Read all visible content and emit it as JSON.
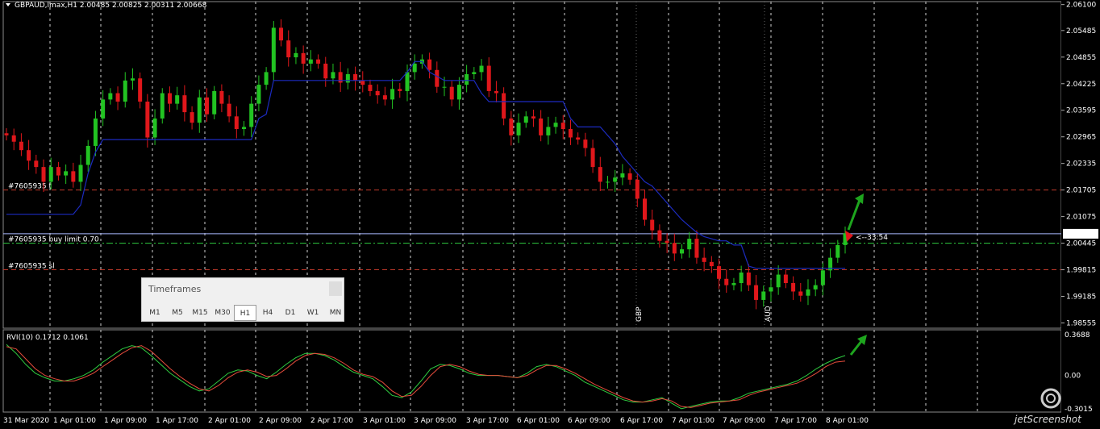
{
  "header": {
    "title": "GBPAUD,lmax,H1  2.00485 2.00825 2.00311 2.00668"
  },
  "chart_data": {
    "type": "candlestick",
    "symbol": "GBPAUD,lmax",
    "timeframe": "H1",
    "ohlc_header": [
      2.00485,
      2.00825,
      2.00311,
      2.00668
    ],
    "y_ticks": [
      "2.06100",
      "2.05485",
      "2.04855",
      "2.04225",
      "2.03595",
      "2.02965",
      "2.02335",
      "2.01705",
      "2.01075",
      "2.00445",
      "1.99815",
      "1.99185",
      "1.98555"
    ],
    "x_ticks": [
      "31 Mar 2020",
      "1 Apr 01:00",
      "1 Apr 09:00",
      "1 Apr 17:00",
      "2 Apr 01:00",
      "2 Apr 09:00",
      "2 Apr 17:00",
      "3 Apr 01:00",
      "3 Apr 09:00",
      "3 Apr 17:00",
      "6 Apr 01:00",
      "6 Apr 09:00",
      "6 Apr 17:00",
      "7 Apr 01:00",
      "7 Apr 09:00",
      "7 Apr 17:00",
      "8 Apr 01:00"
    ],
    "ylim": [
      1.9843,
      2.0617
    ],
    "current_price": "2.00668",
    "countdown": "<--33:54",
    "order_lines": [
      {
        "label": "#7605935 t",
        "price": 2.01705,
        "color": "#c0392b",
        "dash": "dashed"
      },
      {
        "label": "#7605935 buy limit 0.70",
        "price": 2.00445,
        "color": "#2ecc40",
        "dash": "dashdot"
      },
      {
        "label": "#7605935 sl",
        "price": 1.99815,
        "color": "#c0392b",
        "dash": "dashed"
      }
    ],
    "events": [
      "GBP",
      "AUD"
    ],
    "close_series": [
      2.03,
      2.0285,
      2.0265,
      2.024,
      2.0225,
      2.019,
      2.0225,
      2.0205,
      2.0215,
      2.019,
      2.023,
      2.0275,
      2.034,
      2.0385,
      2.04,
      2.038,
      2.043,
      2.0435,
      2.038,
      2.0295,
      2.034,
      2.04,
      2.0375,
      2.0395,
      2.0355,
      2.033,
      2.039,
      2.035,
      2.0405,
      2.0375,
      2.0345,
      2.0315,
      2.032,
      2.0375,
      2.042,
      2.045,
      2.0555,
      2.0525,
      2.0485,
      2.0495,
      2.047,
      2.048,
      2.047,
      2.0435,
      2.045,
      2.0425,
      2.0445,
      2.043,
      2.042,
      2.0405,
      2.0395,
      2.0385,
      2.041,
      2.0405,
      2.045,
      2.047,
      2.048,
      2.0455,
      2.0415,
      2.0415,
      2.0385,
      2.042,
      2.0445,
      2.045,
      2.0465,
      2.0405,
      2.04,
      2.034,
      2.03,
      2.033,
      2.0345,
      2.034,
      2.03,
      2.032,
      2.033,
      2.0315,
      2.0295,
      2.029,
      2.027,
      2.0225,
      2.019,
      2.019,
      2.02,
      2.021,
      2.0195,
      2.015,
      2.01,
      2.0075,
      2.005,
      2.0045,
      2.002,
      2.003,
      2.0055,
      2.001,
      2.0,
      1.999,
      1.996,
      1.9945,
      1.995,
      1.9975,
      1.9945,
      1.991,
      1.993,
      1.994,
      1.997,
      1.995,
      1.993,
      1.992,
      1.9935,
      1.9945,
      1.998,
      2.001,
      2.004,
      2.0068
    ],
    "line_series": [
      {
        "name": "",
        "color": "#1c2bbf",
        "values": [
          2.0113,
          2.0113,
          2.0113,
          2.0113,
          2.0113,
          2.0113,
          2.0113,
          2.0113,
          2.0113,
          2.0113,
          2.0135,
          2.021,
          2.026,
          2.029,
          2.029,
          2.029,
          2.029,
          2.029,
          2.029,
          2.029,
          2.029,
          2.029,
          2.029,
          2.029,
          2.029,
          2.029,
          2.029,
          2.029,
          2.029,
          2.029,
          2.029,
          2.029,
          2.029,
          2.029,
          2.034,
          2.035,
          2.043,
          2.043,
          2.043,
          2.043,
          2.043,
          2.043,
          2.043,
          2.043,
          2.043,
          2.043,
          2.043,
          2.043,
          2.043,
          2.043,
          2.043,
          2.043,
          2.043,
          2.043,
          2.045,
          2.0475,
          2.0475,
          2.045,
          2.044,
          2.043,
          2.043,
          2.043,
          2.043,
          2.043,
          2.04,
          2.038,
          2.038,
          2.038,
          2.038,
          2.038,
          2.038,
          2.038,
          2.038,
          2.038,
          2.038,
          2.038,
          2.034,
          2.032,
          2.032,
          2.032,
          2.032,
          2.03,
          2.028,
          2.025,
          2.023,
          2.021,
          2.019,
          2.018,
          2.016,
          2.014,
          2.012,
          2.01,
          2.0085,
          2.007,
          2.006,
          2.0055,
          2.005,
          2.005,
          2.004,
          2.004,
          1.999,
          1.9985,
          1.9985,
          1.9985,
          1.9985,
          1.9985,
          1.9985,
          1.9985,
          1.9985,
          1.9985,
          1.9985,
          1.9985,
          1.9985,
          1.9985
        ]
      }
    ],
    "sub_window": {
      "title": "RVI(10) 0.1712 0.1061",
      "ylim": [
        -0.3015,
        0.3688
      ],
      "y_ticks": [
        "0.3688",
        "0.00",
        "-0.3015"
      ],
      "series": [
        {
          "name": "",
          "color": "#2ecc40",
          "values": [
            0.28,
            0.2,
            0.1,
            0.02,
            -0.02,
            -0.05,
            -0.05,
            -0.03,
            0.0,
            0.05,
            0.12,
            0.18,
            0.24,
            0.27,
            0.25,
            0.18,
            0.1,
            0.02,
            -0.04,
            -0.1,
            -0.14,
            -0.12,
            -0.05,
            0.02,
            0.05,
            0.04,
            0.0,
            -0.03,
            0.03,
            0.1,
            0.16,
            0.2,
            0.2,
            0.18,
            0.14,
            0.08,
            0.03,
            0.0,
            -0.03,
            -0.1,
            -0.18,
            -0.2,
            -0.15,
            -0.05,
            0.06,
            0.1,
            0.09,
            0.06,
            0.02,
            0.0,
            0.0,
            0.0,
            -0.01,
            -0.02,
            0.02,
            0.08,
            0.1,
            0.08,
            0.04,
            0.0,
            -0.06,
            -0.1,
            -0.14,
            -0.18,
            -0.22,
            -0.24,
            -0.24,
            -0.22,
            -0.2,
            -0.25,
            -0.3,
            -0.28,
            -0.26,
            -0.24,
            -0.23,
            -0.23,
            -0.2,
            -0.16,
            -0.14,
            -0.12,
            -0.1,
            -0.08,
            -0.05,
            0.0,
            0.06,
            0.11,
            0.15,
            0.18
          ]
        },
        {
          "name": "",
          "color": "#e74c3c",
          "values": [
            0.26,
            0.24,
            0.15,
            0.06,
            0.0,
            -0.03,
            -0.05,
            -0.05,
            -0.02,
            0.02,
            0.08,
            0.14,
            0.2,
            0.25,
            0.27,
            0.22,
            0.14,
            0.06,
            -0.01,
            -0.07,
            -0.12,
            -0.14,
            -0.09,
            -0.02,
            0.03,
            0.05,
            0.03,
            -0.01,
            0.0,
            0.06,
            0.13,
            0.18,
            0.2,
            0.19,
            0.16,
            0.11,
            0.05,
            0.01,
            -0.01,
            -0.06,
            -0.14,
            -0.19,
            -0.18,
            -0.1,
            0.0,
            0.08,
            0.1,
            0.08,
            0.04,
            0.01,
            0.0,
            0.0,
            -0.01,
            -0.02,
            0.0,
            0.05,
            0.09,
            0.09,
            0.06,
            0.02,
            -0.03,
            -0.08,
            -0.12,
            -0.16,
            -0.2,
            -0.23,
            -0.24,
            -0.23,
            -0.21,
            -0.23,
            -0.28,
            -0.29,
            -0.27,
            -0.25,
            -0.24,
            -0.23,
            -0.22,
            -0.18,
            -0.15,
            -0.13,
            -0.11,
            -0.09,
            -0.07,
            -0.03,
            0.02,
            0.08,
            0.12,
            0.13
          ]
        }
      ]
    }
  },
  "timeframes_panel": {
    "title": "Timeframes",
    "buttons": [
      "M1",
      "M5",
      "M15",
      "M30",
      "H1",
      "H4",
      "D1",
      "W1",
      "MN"
    ],
    "selected": "H1"
  },
  "watermark": "jetScreenshot"
}
